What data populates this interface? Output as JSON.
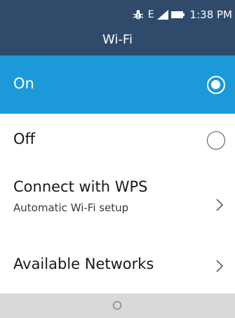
{
  "status_bar": {
    "network_type": "E",
    "time": "1:38 PM",
    "icons": [
      "bug-icon",
      "signal-icon",
      "battery-icon"
    ]
  },
  "header": {
    "title": "Wi-Fi"
  },
  "options": {
    "on": {
      "label": "On",
      "selected": true
    },
    "off": {
      "label": "Off",
      "selected": false
    }
  },
  "menu": {
    "wps": {
      "label": "Connect with WPS",
      "subtitle": "Automatic Wi-Fi setup"
    },
    "available": {
      "label": "Available Networks"
    }
  },
  "softkeys": {
    "center_icon": "circle-select-icon"
  },
  "colors": {
    "header_bg": "#2f4a6b",
    "highlight": "#1c99d8",
    "softbar_bg": "#d9d9d9"
  }
}
